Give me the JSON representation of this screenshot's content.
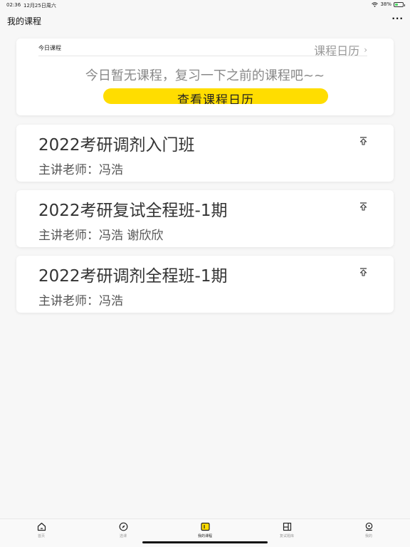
{
  "status_bar": {
    "time": "02:36",
    "date": "12月25日周六",
    "battery": "38%",
    "battery_fraction": 0.38
  },
  "header": {
    "title": "我的课程",
    "more_label": "···"
  },
  "today": {
    "label": "今日课程",
    "calendar_link": "课程日历",
    "empty_message": "今日暂无课程，复习一下之前的课程吧~~",
    "button_label": "查看课程日历"
  },
  "courses": [
    {
      "title": "2022考研调剂入门班",
      "teacher": "主讲老师：冯浩"
    },
    {
      "title": "2022考研复试全程班-1期",
      "teacher": "主讲老师：冯浩  谢欣欣"
    },
    {
      "title": "2022考研调剂全程班-1期",
      "teacher": "主讲老师：冯浩"
    }
  ],
  "tabs": [
    {
      "label": "首页",
      "icon": "home-icon"
    },
    {
      "label": "选课",
      "icon": "compass-icon"
    },
    {
      "label": "我的课程",
      "icon": "my-courses-icon"
    },
    {
      "label": "复试题库",
      "icon": "question-bank-icon"
    },
    {
      "label": "我的",
      "icon": "profile-icon"
    }
  ],
  "colors": {
    "accent": "#ffdd00",
    "background": "#f7f7f7",
    "card": "#ffffff"
  }
}
